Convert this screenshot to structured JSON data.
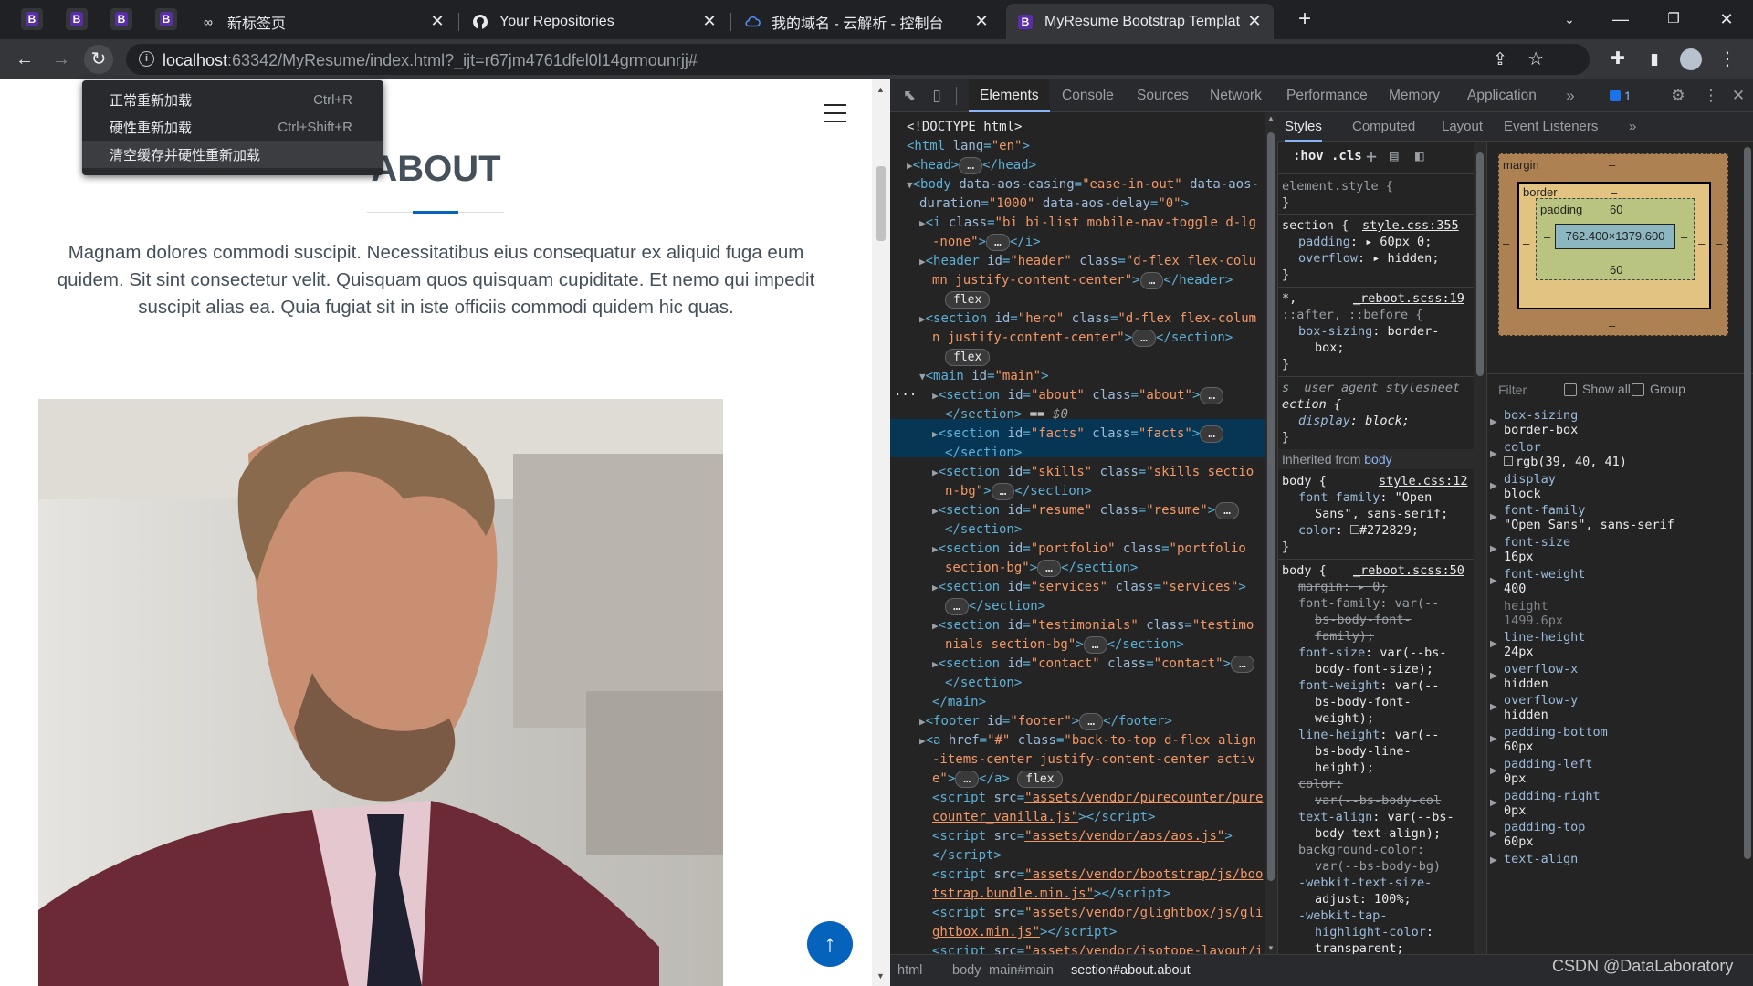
{
  "browser": {
    "pinned_tabs": [
      "B",
      "B",
      "B",
      "B"
    ],
    "tabs": [
      {
        "title": "新标签页",
        "icon": "infinity-icon"
      },
      {
        "title": "Your Repositories",
        "icon": "github-icon"
      },
      {
        "title": "我的域名 - 云解析 - 控制台",
        "icon": "cloud-icon"
      },
      {
        "title": "MyResume Bootstrap Templat",
        "icon": "bootstrap-icon",
        "active": true
      }
    ],
    "url_host": "localhost",
    "url_rest": ":63342/MyResume/index.html?_ijt=r67jm4761dfel0l14grmounrjj#"
  },
  "context_menu": {
    "items": [
      {
        "label": "正常重新加载",
        "shortcut": "Ctrl+R"
      },
      {
        "label": "硬性重新加载",
        "shortcut": "Ctrl+Shift+R"
      },
      {
        "label": "清空缓存并硬性重新加载",
        "shortcut": ""
      }
    ]
  },
  "page": {
    "section_title": "ABOUT",
    "about_text": "Magnam dolores commodi suscipit. Necessitatibus eius consequatur ex aliquid fuga eum quidem. Sit sint consectetur velit. Quisquam quos quisquam cupiditate. Et nemo qui impedit suscipit alias ea. Quia fugiat sit in iste officiis commodi quidem hic quas.",
    "back_to_top": "↑"
  },
  "devtools": {
    "tabs": [
      "Elements",
      "Console",
      "Sources",
      "Network",
      "Performance",
      "Memory",
      "Application"
    ],
    "issues_count": "1",
    "styles_tabs": [
      "Styles",
      "Computed",
      "Layout",
      "Event Listeners"
    ],
    "filter_tools": {
      "hov": ":hov",
      "cls": ".cls"
    },
    "breadcrumbs": [
      "html",
      "body",
      "main#main",
      "section#about.about"
    ],
    "box_model": {
      "margin_label": "margin",
      "border_label": "border",
      "padding_label": "padding",
      "margin": "–",
      "border": "–",
      "padding_top": "60",
      "padding_bottom": "60",
      "padding_sides": "–",
      "content": "762.400×1379.600"
    },
    "computed_filter": {
      "placeholder": "Filter",
      "show_all": "Show all",
      "group": "Group"
    },
    "computed": [
      {
        "name": "box-sizing",
        "value": "border-box"
      },
      {
        "name": "color",
        "value": "rgb(39, 40, 41)"
      },
      {
        "name": "display",
        "value": "block"
      },
      {
        "name": "font-family",
        "value": "\"Open Sans\", sans-serif"
      },
      {
        "name": "font-size",
        "value": "16px"
      },
      {
        "name": "font-weight",
        "value": "400"
      },
      {
        "name": "height",
        "value": "1499.6px"
      },
      {
        "name": "line-height",
        "value": "24px"
      },
      {
        "name": "overflow-x",
        "value": "hidden"
      },
      {
        "name": "overflow-y",
        "value": "hidden"
      },
      {
        "name": "padding-bottom",
        "value": "60px"
      },
      {
        "name": "padding-left",
        "value": "0px"
      },
      {
        "name": "padding-right",
        "value": "0px"
      },
      {
        "name": "padding-top",
        "value": "60px"
      },
      {
        "name": "text-align",
        "value": ""
      }
    ],
    "styles": {
      "element_style": "element.style {",
      "section_rule": {
        "selector": "section {",
        "source": "style.css:355",
        "padding": "60px 0;",
        "overflow": "hidden;"
      },
      "universal_rule": {
        "selector": "*,",
        "source": "_reboot.scss:19",
        "pseudo": "::after, ::before {",
        "box_sizing": "border-box;"
      },
      "ua_rule": {
        "label": "user agent stylesheet",
        "selector": "section {",
        "display": "block;"
      },
      "inherited_label": "Inherited from",
      "inherited_from": "body",
      "body_rule_1": {
        "source": "style.css:12",
        "font_family": "\"Open Sans\", sans-serif;",
        "color": "#272829;"
      },
      "body_rule_2": {
        "source": "_reboot.scss:50"
      }
    }
  },
  "watermark": "CSDN @DataLaboratory"
}
